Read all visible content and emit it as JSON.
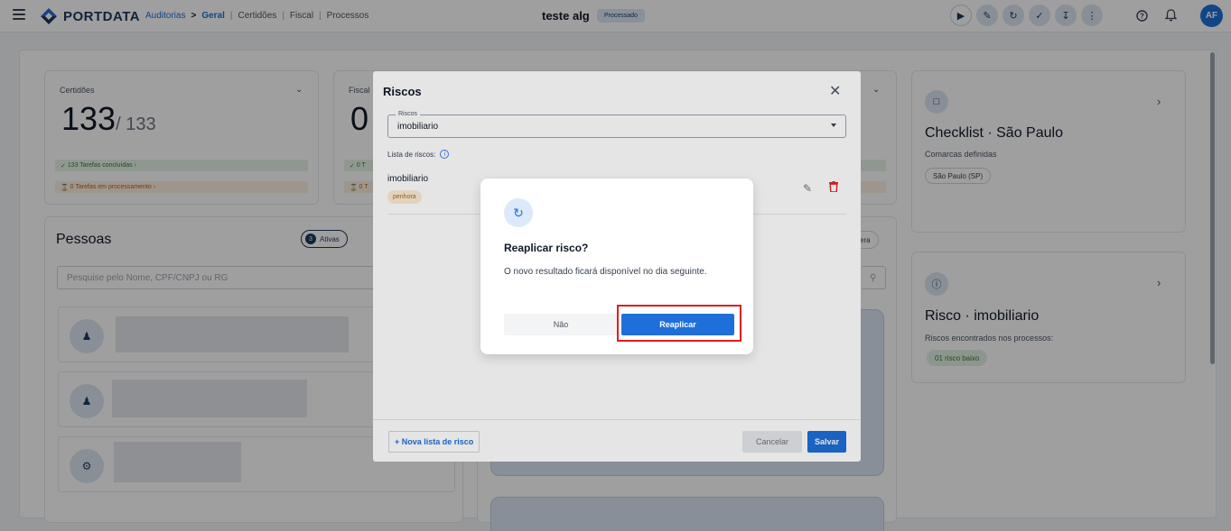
{
  "topbar": {
    "brand": "PORTDATA",
    "breadcrumbs": {
      "root": "Auditorias",
      "current": "Geral",
      "tab2": "Certidões",
      "tab3": "Fiscal",
      "tab4": "Processos"
    },
    "doc_title": "teste alg",
    "status": "Processado",
    "avatar_initials": "AF"
  },
  "certidoes_card": {
    "label": "Certidões",
    "count": "133",
    "total": "/ 133",
    "done": "133 Tarefas concluídas",
    "processing": "0 Tarefas em processamento"
  },
  "fiscal_card": {
    "label": "Fiscal",
    "count": "0",
    "done": "0 T",
    "processing": "0 T"
  },
  "pessoas": {
    "title": "Pessoas",
    "active_count": "3",
    "active_label": "Ativas",
    "search_placeholder": "Pesquise pelo Nome, CPF/CNPJ ou RG"
  },
  "right_partial": {
    "chip": "era"
  },
  "checklist_card": {
    "title": "Checklist · São Paulo",
    "subtitle": "Comarcas definidas",
    "pill": "São Paulo (SP)"
  },
  "risco_card": {
    "title": "Risco · imobiliario",
    "subtitle": "Riscos encontrados nos processos:",
    "pill": "01 risco baixo"
  },
  "riscos_modal": {
    "title": "Riscos",
    "select_label": "Riscos",
    "select_value": "imobiliario",
    "list_label": "Lista de riscos:",
    "risk_name": "imobiliario",
    "risk_tag": "penhora",
    "new_list_button": "+ Nova lista de risco",
    "cancel_button": "Cancelar",
    "save_button": "Salvar"
  },
  "confirm_dialog": {
    "title": "Reaplicar risco?",
    "text": "O novo resultado ficará disponível no dia seguinte.",
    "no_button": "Não",
    "confirm_button": "Reaplicar"
  },
  "colors": {
    "primary": "#1e6fd9",
    "brand_dark": "#1e3a5f",
    "highlight": "#e11d1d"
  }
}
